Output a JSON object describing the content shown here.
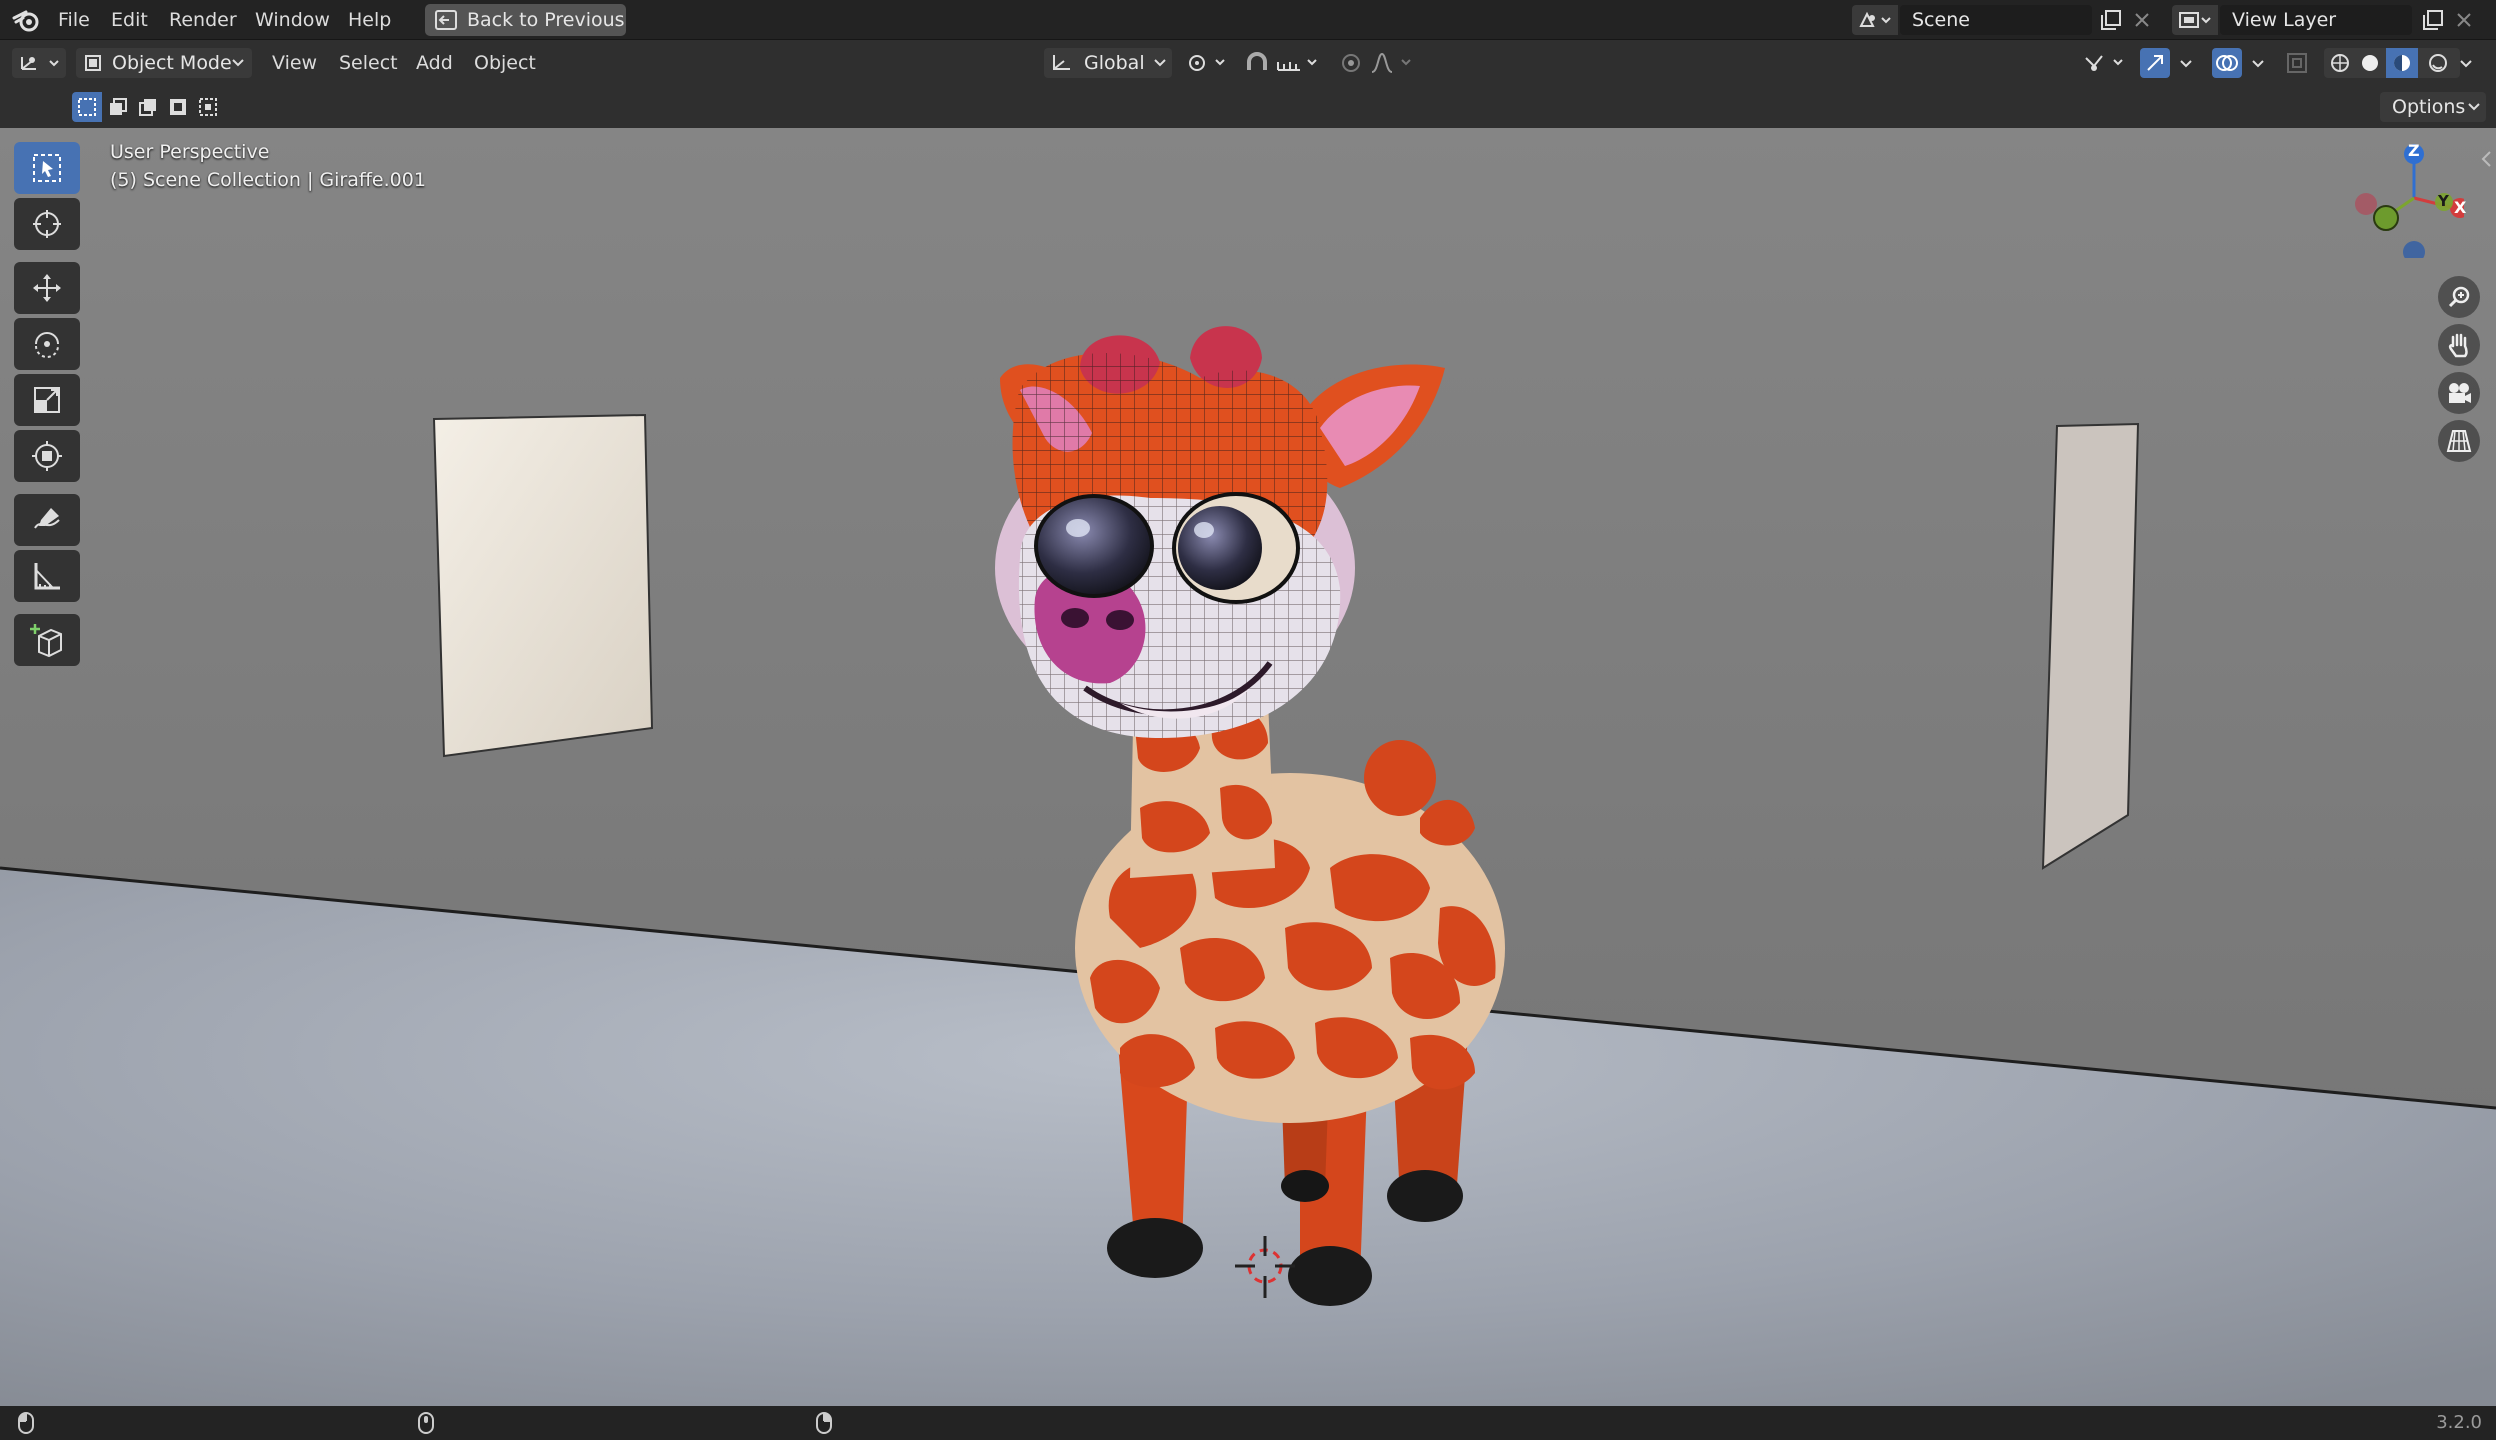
{
  "topbar": {
    "menus": [
      "File",
      "Edit",
      "Render",
      "Window",
      "Help"
    ],
    "back_button": "Back to Previous",
    "scene_name": "Scene",
    "view_layer": "View Layer"
  },
  "header": {
    "mode": "Object Mode",
    "menus": [
      "View",
      "Select",
      "Add",
      "Object"
    ],
    "orientation": "Global",
    "options": "Options"
  },
  "viewport": {
    "view_name": "User Perspective",
    "collection_info": "(5) Scene Collection | Giraffe.001",
    "gizmo_axes": [
      "Z",
      "Y",
      "X"
    ]
  },
  "toolbar": {
    "tools": [
      "select-box",
      "cursor",
      "move",
      "rotate",
      "scale",
      "transform",
      "annotate",
      "measure",
      "add-cube"
    ]
  },
  "statusbar": {
    "version": "3.2.0"
  },
  "colors": {
    "accent": "#4772b3",
    "giraffe_orange": "#d4471c",
    "giraffe_spots_bg": "#e8c7a0",
    "wall": "#7c7c7c",
    "floor": "#a3a9b3"
  }
}
